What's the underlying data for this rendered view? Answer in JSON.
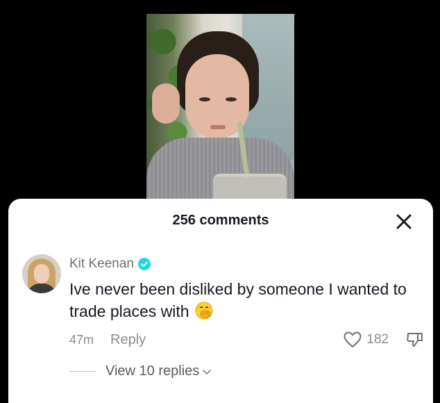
{
  "sheet": {
    "title": "256 comments"
  },
  "comment": {
    "author": "Kit Keenan",
    "text": "Ive never been disliked by someone I wanted to trade places with",
    "emoji": "hand-over-mouth-emoji",
    "timestamp": "47m",
    "reply_label": "Reply",
    "like_count": "182",
    "view_replies_label": "View 10 replies"
  },
  "icons": {
    "close": "close-icon",
    "verified": "verified-badge-icon",
    "like": "heart-icon",
    "dislike": "thumbs-down-icon",
    "expand": "chevron-down-icon"
  },
  "colors": {
    "verified": "#20d5ec",
    "text_primary": "#161823",
    "text_secondary": "#8a8b91"
  }
}
